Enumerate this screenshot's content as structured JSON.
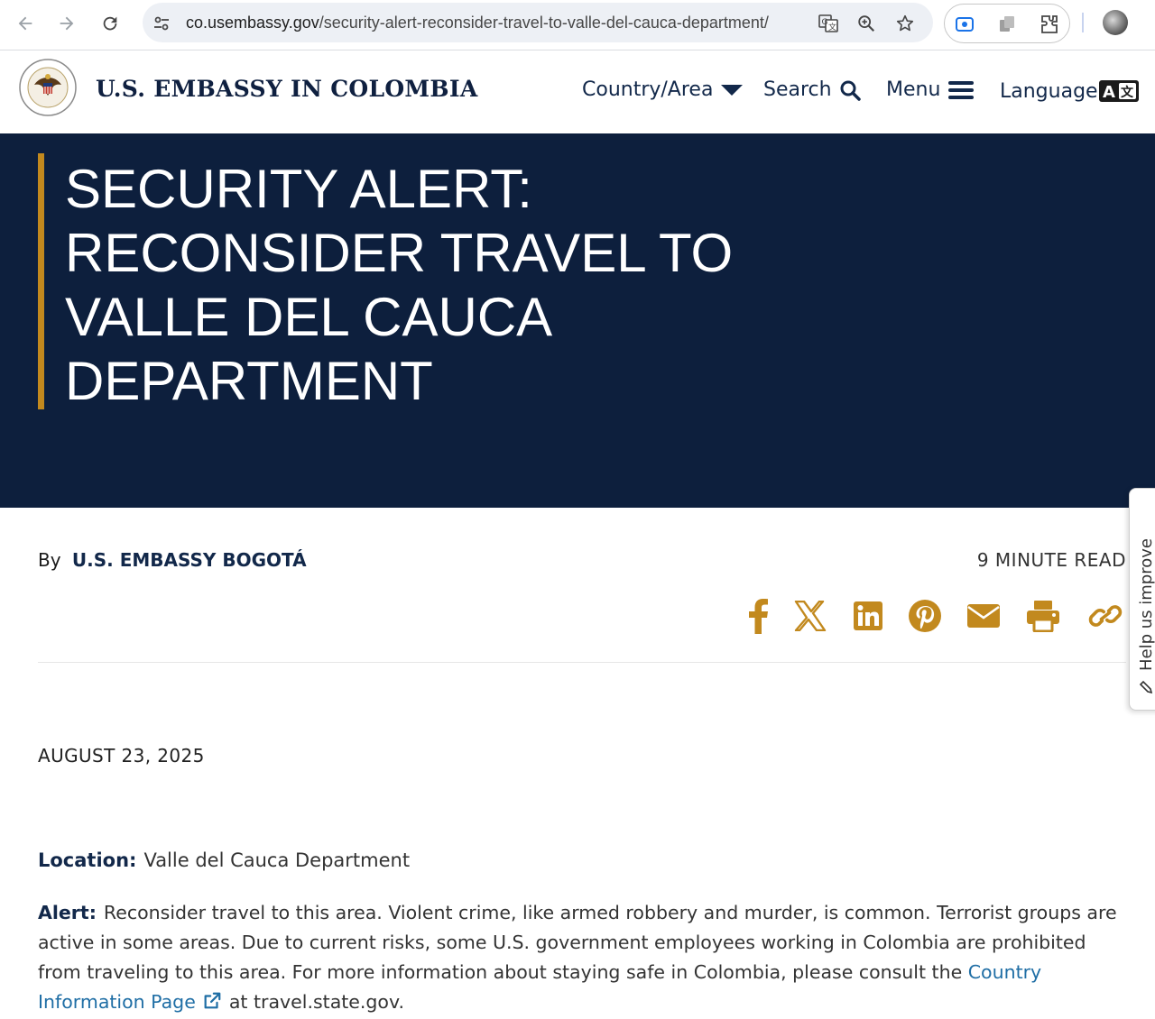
{
  "browser": {
    "url_host": "co.usembassy.gov",
    "url_path": "/security-alert-reconsider-travel-to-valle-del-cauca-department/"
  },
  "header": {
    "site_title": "U.S. EMBASSY IN COLOMBIA",
    "nav": {
      "country_label": "Country/Area",
      "search_label": "Search",
      "menu_label": "Menu",
      "language_label": "Language"
    }
  },
  "hero": {
    "title": "SECURITY ALERT: RECONSIDER TRAVEL TO VALLE DEL CAUCA DEPARTMENT"
  },
  "article": {
    "by_label": "By",
    "author": "U.S. EMBASSY BOGOTÁ",
    "read_time": "9 MINUTE READ",
    "share_icons": [
      "facebook-icon",
      "x-icon",
      "linkedin-icon",
      "pinterest-icon",
      "email-icon",
      "print-icon",
      "copy-link-icon"
    ],
    "date": "AUGUST 23, 2025",
    "location_label": "Location:",
    "location_value": "Valle del Cauca Department",
    "alert_label": "Alert:",
    "alert_text": "Reconsider travel to this area. Violent crime, like armed robbery and murder, is common. Terrorist groups are active in some areas. Due to current risks, some U.S. government employees working in Colombia are prohibited from traveling to this area. For more information about staying safe in Colombia, please consult the",
    "alert_link": "Country Information Page",
    "alert_tail": "at travel.state.gov."
  },
  "feedback": {
    "label": "Help us improve"
  },
  "colors": {
    "navy": "#0d1f3d",
    "gold": "#c2891e",
    "link": "#1f6ea5"
  }
}
